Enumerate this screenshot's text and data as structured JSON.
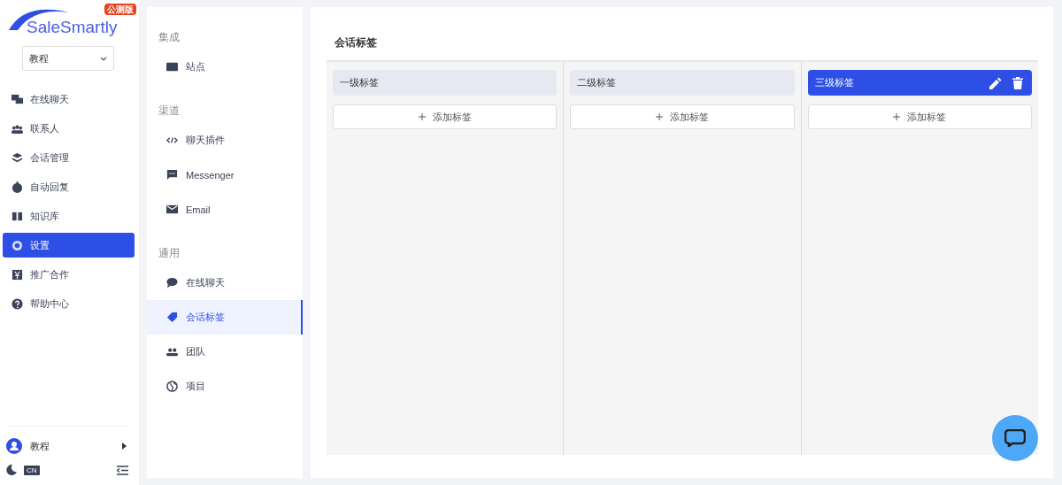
{
  "brand": {
    "logo": "SaleSmartly",
    "badge": "公测版"
  },
  "workspace": {
    "value": "教程"
  },
  "nav": [
    {
      "label": "在线聊天",
      "selected": false
    },
    {
      "label": "联系人",
      "selected": false
    },
    {
      "label": "会话管理",
      "selected": false
    },
    {
      "label": "自动回复",
      "selected": false
    },
    {
      "label": "知识库",
      "selected": false
    },
    {
      "label": "设置",
      "selected": true
    },
    {
      "label": "推广合作",
      "selected": false
    },
    {
      "label": "帮助中心",
      "selected": false
    }
  ],
  "user": {
    "name": "教程",
    "language": "CN"
  },
  "settings_menu": [
    {
      "heading": "集成",
      "items": [
        {
          "label": "站点",
          "selected": false
        }
      ]
    },
    {
      "heading": "渠道",
      "items": [
        {
          "label": "聊天插件",
          "selected": false
        },
        {
          "label": "Messenger",
          "selected": false
        },
        {
          "label": "Email",
          "selected": false
        }
      ]
    },
    {
      "heading": "通用",
      "items": [
        {
          "label": "在线聊天",
          "selected": false
        },
        {
          "label": "会话标签",
          "selected": true
        },
        {
          "label": "团队",
          "selected": false
        },
        {
          "label": "项目",
          "selected": false
        }
      ]
    }
  ],
  "page_title": "会话标签",
  "tag_columns": [
    {
      "label": "一级标签",
      "selected": false,
      "add": "添加标签"
    },
    {
      "label": "二级标签",
      "selected": false,
      "add": "添加标签"
    },
    {
      "label": "三级标签",
      "selected": true,
      "add": "添加标签"
    }
  ]
}
